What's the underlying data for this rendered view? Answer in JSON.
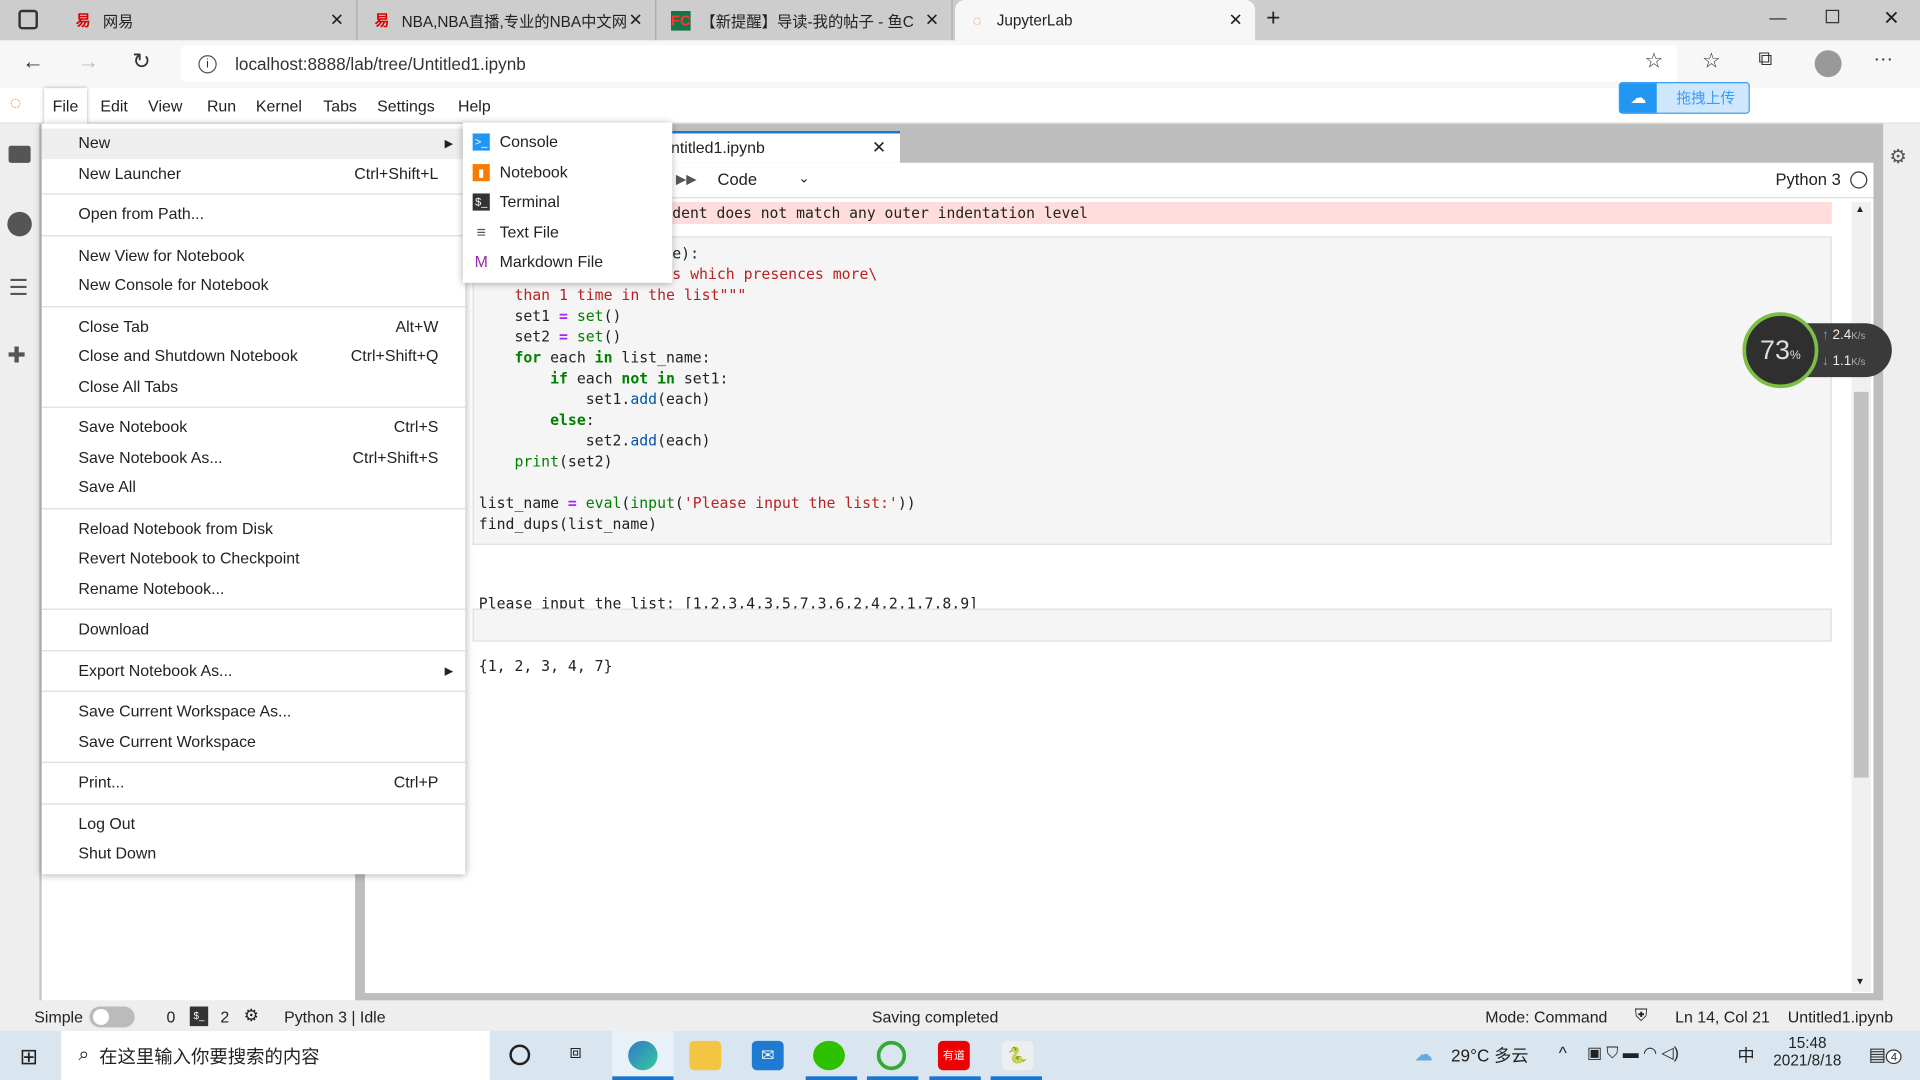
{
  "browser": {
    "tabs": [
      {
        "title": "网易",
        "icon": "netease-icon"
      },
      {
        "title": "NBA,NBA直播,专业的NBA中文网",
        "icon": "netease-icon"
      },
      {
        "title": "【新提醒】导读-我的帖子 - 鱼C",
        "icon": "fishc-icon"
      },
      {
        "title": "JupyterLab",
        "icon": "jupyter-icon",
        "active": true
      }
    ],
    "url": "localhost:8888/lab/tree/Untitled1.ipynb",
    "upload_badge": "拖拽上传"
  },
  "menubar": [
    "File",
    "Edit",
    "View",
    "Run",
    "Kernel",
    "Tabs",
    "Settings",
    "Help"
  ],
  "file_menu": [
    [
      {
        "label": "New",
        "submenu": true,
        "highlighted": true
      },
      {
        "label": "New Launcher",
        "shortcut": "Ctrl+Shift+L"
      }
    ],
    [
      {
        "label": "Open from Path..."
      }
    ],
    [
      {
        "label": "New View for Notebook"
      },
      {
        "label": "New Console for Notebook"
      }
    ],
    [
      {
        "label": "Close Tab",
        "shortcut": "Alt+W"
      },
      {
        "label": "Close and Shutdown Notebook",
        "shortcut": "Ctrl+Shift+Q"
      },
      {
        "label": "Close All Tabs"
      }
    ],
    [
      {
        "label": "Save Notebook",
        "shortcut": "Ctrl+S"
      },
      {
        "label": "Save Notebook As...",
        "shortcut": "Ctrl+Shift+S"
      },
      {
        "label": "Save All"
      }
    ],
    [
      {
        "label": "Reload Notebook from Disk"
      },
      {
        "label": "Revert Notebook to Checkpoint"
      },
      {
        "label": "Rename Notebook..."
      }
    ],
    [
      {
        "label": "Download"
      }
    ],
    [
      {
        "label": "Export Notebook As...",
        "submenu": true
      }
    ],
    [
      {
        "label": "Save Current Workspace As..."
      },
      {
        "label": "Save Current Workspace"
      }
    ],
    [
      {
        "label": "Print...",
        "shortcut": "Ctrl+P"
      }
    ],
    [
      {
        "label": "Log Out"
      },
      {
        "label": "Shut Down"
      }
    ]
  ],
  "new_submenu": [
    {
      "label": "Console",
      "icon": "console-icon",
      "color": "#2196f3",
      "glyph": ">_"
    },
    {
      "label": "Notebook",
      "icon": "notebook-icon",
      "color": "#f57c00",
      "glyph": "▮"
    },
    {
      "label": "Terminal",
      "icon": "terminal-icon",
      "color": "#333333",
      "glyph": "$_"
    },
    {
      "label": "Text File",
      "icon": "text-file-icon",
      "color": "#ffffff",
      "glyph": "≡"
    },
    {
      "label": "Markdown File",
      "icon": "markdown-icon",
      "color": "#ffffff",
      "glyph": "M"
    }
  ],
  "notebook": {
    "tab_title": "ntitled1.ipynb",
    "cell_type": "Code",
    "kernel": "Python 3",
    "error_text": "dent does not match any outer indentation level",
    "code_fragments": [
      [
        [
          "e):",
          ""
        ]
      ],
      [
        [
          "s which presences more\\",
          "st"
        ]
      ]
    ],
    "code_lines": [
      [
        [
          "    ",
          ""
        ],
        [
          "than 1 time in the list\"\"\"",
          "st"
        ]
      ],
      [
        [
          "    set1 ",
          ""
        ],
        [
          "=",
          "op"
        ],
        [
          " ",
          ""
        ],
        [
          "set",
          "bi"
        ],
        [
          "()",
          ""
        ]
      ],
      [
        [
          "    set2 ",
          ""
        ],
        [
          "=",
          "op"
        ],
        [
          " ",
          ""
        ],
        [
          "set",
          "bi"
        ],
        [
          "()",
          ""
        ]
      ],
      [
        [
          "    ",
          ""
        ],
        [
          "for",
          "kw"
        ],
        [
          " each ",
          ""
        ],
        [
          "in",
          "kw"
        ],
        [
          " list_name:",
          ""
        ]
      ],
      [
        [
          "        ",
          ""
        ],
        [
          "if",
          "kw"
        ],
        [
          " each ",
          ""
        ],
        [
          "not",
          "kw"
        ],
        [
          " ",
          ""
        ],
        [
          "in",
          "kw"
        ],
        [
          " set1:",
          ""
        ]
      ],
      [
        [
          "            set1.",
          ""
        ],
        [
          "add",
          "fn"
        ],
        [
          "(each)",
          ""
        ]
      ],
      [
        [
          "        ",
          ""
        ],
        [
          "else",
          "kw"
        ],
        [
          ":",
          ""
        ]
      ],
      [
        [
          "            set2.",
          ""
        ],
        [
          "add",
          "fn"
        ],
        [
          "(each)",
          ""
        ]
      ],
      [
        [
          "    ",
          ""
        ],
        [
          "print",
          "bi"
        ],
        [
          "(set2)",
          ""
        ]
      ],
      [
        [
          "",
          ""
        ]
      ],
      [
        [
          "list_name ",
          ""
        ],
        [
          "=",
          "op"
        ],
        [
          " ",
          ""
        ],
        [
          "eval",
          "bi"
        ],
        [
          "(",
          ""
        ],
        [
          "input",
          "bi"
        ],
        [
          "(",
          ""
        ],
        [
          "'Please input the list:'",
          "st"
        ],
        [
          "))",
          ""
        ]
      ],
      [
        [
          "find_dups(list_name)",
          ""
        ]
      ]
    ],
    "output": [
      "Please input the list: [1,2,3,4,3,5,7,3,6,2,4,2,1,7,8,9]",
      "{1, 2, 3, 4, 7}"
    ]
  },
  "net_widget": {
    "cpu": "73",
    "cpu_unit": "%",
    "up": "2.4",
    "down": "1.1",
    "unit": "K/s"
  },
  "statusbar": {
    "simple": "Simple",
    "simple_on": false,
    "terminals": "0",
    "kernels": "2",
    "kernel_status": "Python 3 | Idle",
    "message": "Saving completed",
    "mode": "Mode: Command",
    "cursor": "Ln 14, Col 21",
    "file": "Untitled1.ipynb"
  },
  "taskbar": {
    "search_placeholder": "在这里输入你要搜索的内容",
    "weather": "29°C 多云",
    "ime": "中",
    "time": "15:48",
    "date": "2021/8/18",
    "notifications": "4"
  }
}
